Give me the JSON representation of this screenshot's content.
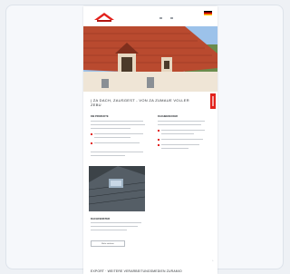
{
  "colors": {
    "accent": "#e2211c",
    "card_bg": "#f6f8fb",
    "page_bg": "#ffffff"
  },
  "header": {
    "logo_icon": "roof-logo-icon",
    "language_icon": "german-flag-icon"
  },
  "content": {
    "headline": "| ZA DACH, ZAUSGEST - VON ZA ZUMAUE VOLLER ZEBU",
    "col_left_title": "DIE PRODUKTE",
    "col_right_title": "DACHBEDECKER",
    "teaser_title": "DACHFENSTER",
    "teaser_button": "Mehr erfahren"
  },
  "footer": {
    "heading": "EXPORT · WEITERE VERARBEITUNGSMEDIEN ZURAMIO"
  }
}
